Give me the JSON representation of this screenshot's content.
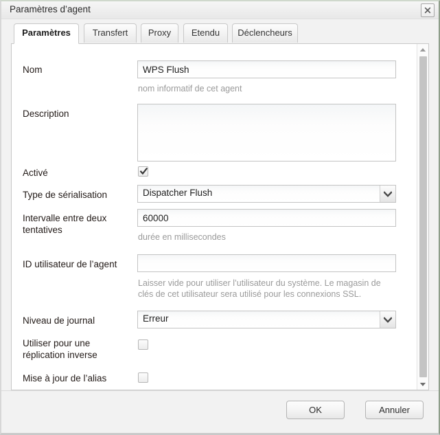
{
  "window": {
    "title": "Paramètres d’agent",
    "close_icon": "close-icon"
  },
  "tabs": [
    {
      "label": "Paramètres",
      "active": true
    },
    {
      "label": "Transfert",
      "active": false
    },
    {
      "label": "Proxy",
      "active": false
    },
    {
      "label": "Etendu",
      "active": false
    },
    {
      "label": "Déclencheurs",
      "active": false
    }
  ],
  "form": {
    "name": {
      "label": "Nom",
      "value": "WPS Flush",
      "hint": "nom informatif de cet agent"
    },
    "description": {
      "label": "Description",
      "value": "",
      "hint": ""
    },
    "enabled": {
      "label": "Activé",
      "checked": true
    },
    "serialization_type": {
      "label": "Type de sérialisation",
      "value": "Dispatcher Flush",
      "options": [
        "Dispatcher Flush"
      ]
    },
    "retry_interval": {
      "label": "Intervalle entre deux tentatives",
      "value": "60000",
      "hint": "durée en millisecondes"
    },
    "agent_user_id": {
      "label": "ID utilisateur de l’agent",
      "value": "",
      "hint": "Laisser vide pour utiliser l’utilisateur du système. Le magasin de clés de cet utilisateur sera utilisé pour les connexions SSL."
    },
    "log_level": {
      "label": "Niveau de journal",
      "value": "Erreur",
      "options": [
        "Erreur"
      ]
    },
    "reverse_replication": {
      "label": "Utiliser pour une réplication inverse",
      "checked": false
    },
    "alias_update": {
      "label": "Mise à jour de l’alias",
      "checked": false
    }
  },
  "scrollbar": {
    "up_icon": "scroll-up-arrow-icon",
    "down_icon": "scroll-down-arrow-icon"
  },
  "footer": {
    "ok_label": "OK",
    "cancel_label": "Annuler"
  },
  "colors": {
    "panel_background": "#ffffff",
    "chrome_background": "#f2f2f2",
    "label_text": "#221a17",
    "hint_text": "#9a9a9a",
    "scrollbar_thumb": "#c4c4c4"
  }
}
